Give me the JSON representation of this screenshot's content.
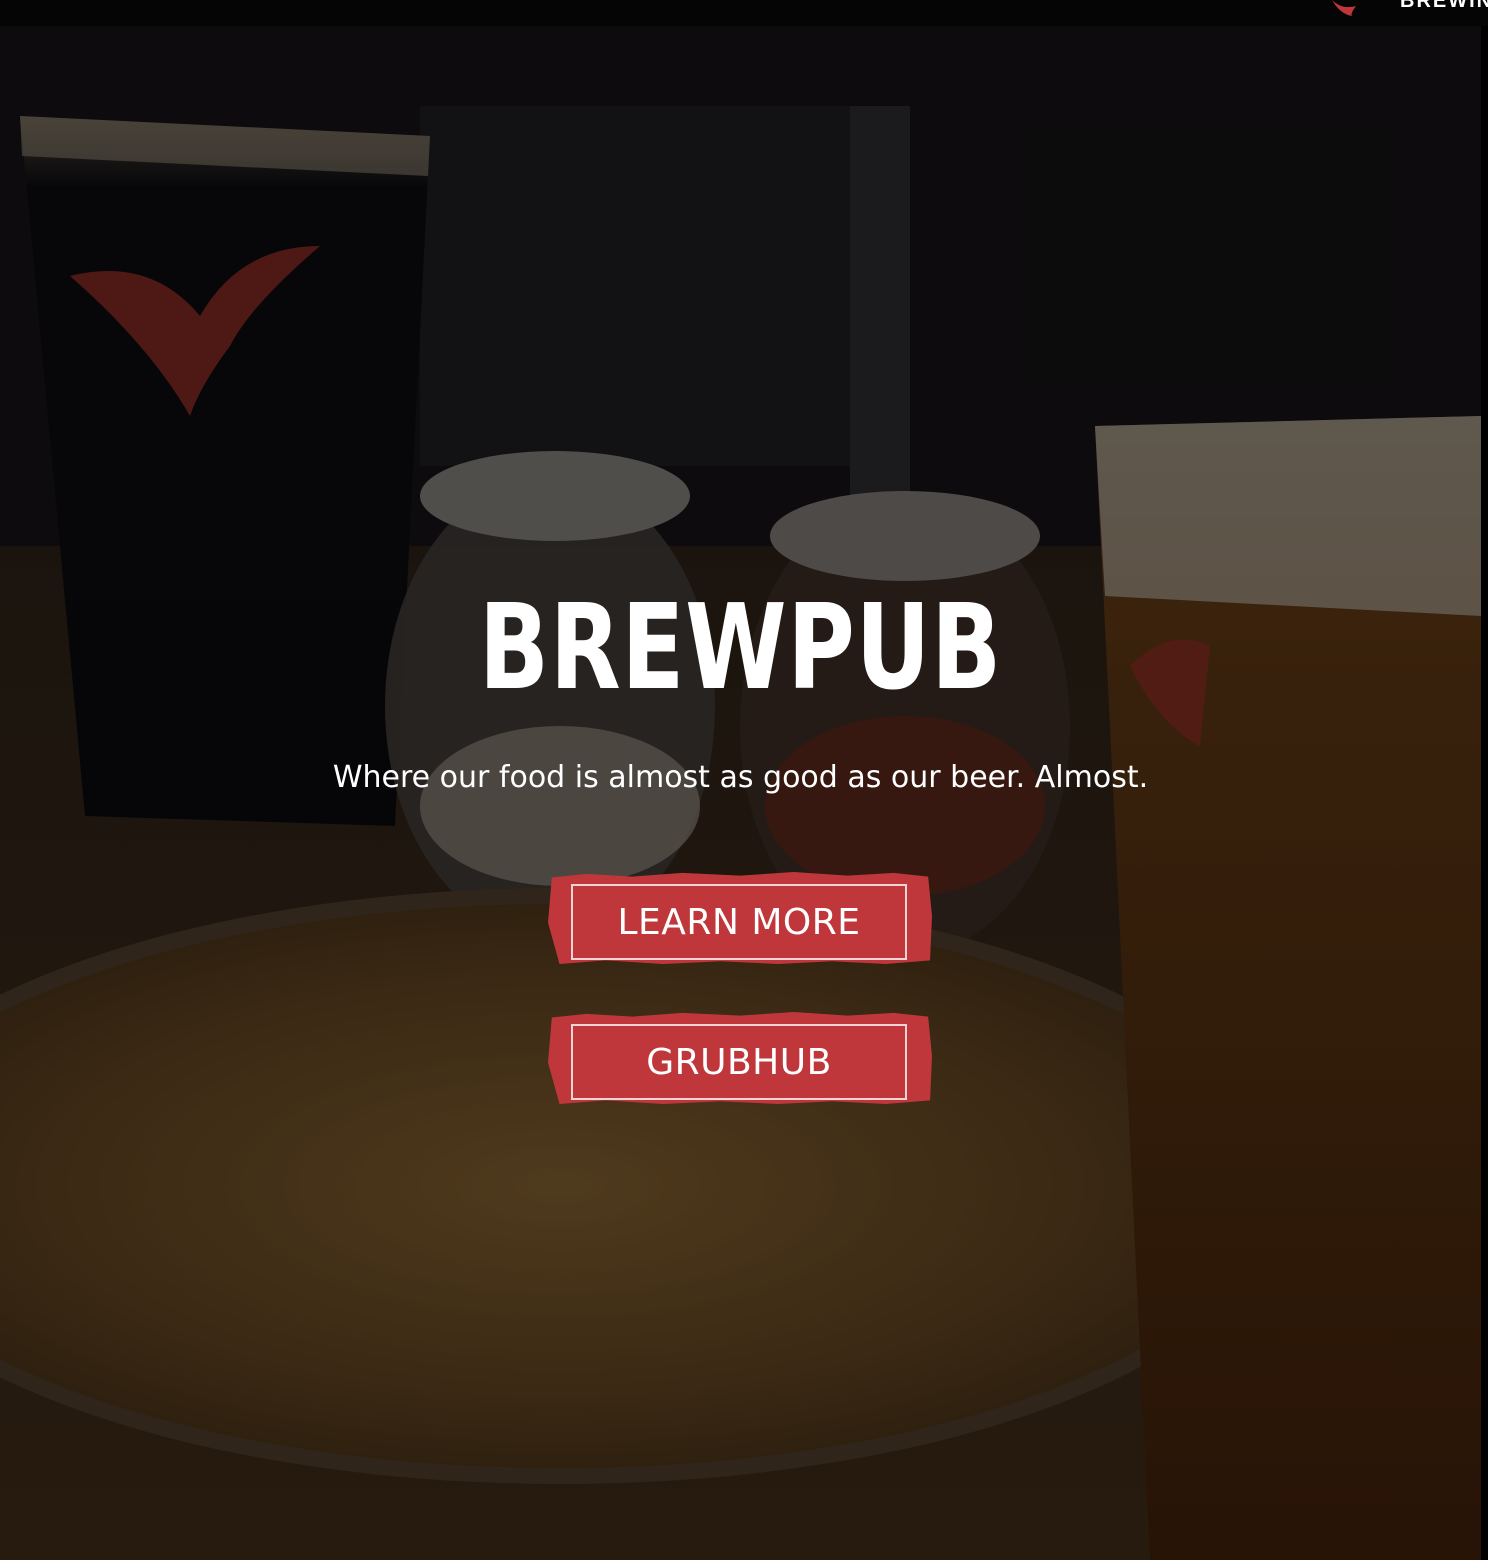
{
  "header": {
    "logo_text": "BREWING"
  },
  "hero": {
    "title": "BREWPUB",
    "subtitle": "Where our food is almost as good as our beer. Almost."
  },
  "buttons": {
    "learn_more": "LEARN MORE",
    "grubhub": "GRUBHUB"
  },
  "colors": {
    "button_red": "#c0373b",
    "text_white": "#ffffff",
    "topbar_black": "#050505"
  }
}
